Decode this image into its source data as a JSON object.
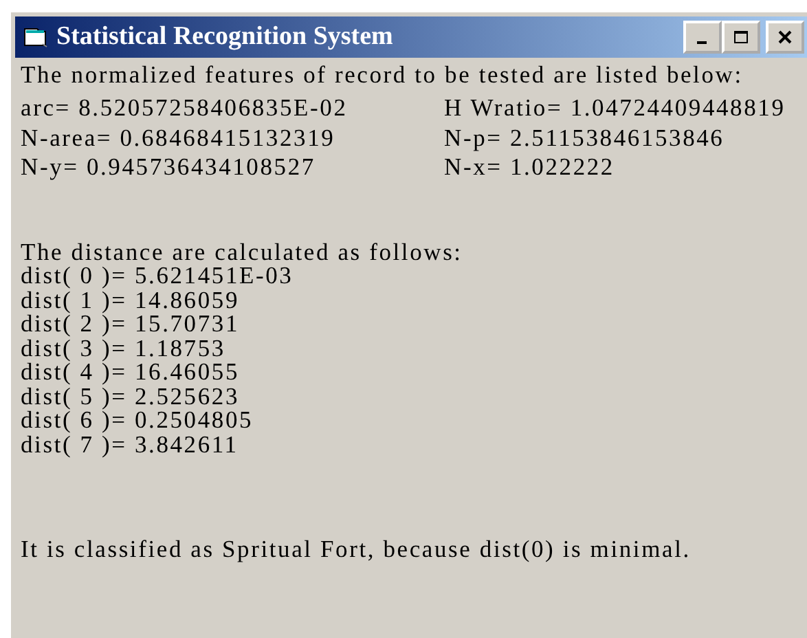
{
  "window": {
    "title": "Statistical Recognition System"
  },
  "intro": "The normalized features of record to be tested are listed below:",
  "features": [
    [
      "arc= 8.52057258406835E-02",
      "H Wratio= 1.04724409448819"
    ],
    [
      "N-area= 0.68468415132319",
      "N-p= 2.51153846153846"
    ],
    [
      "N-y=  0.945736434108527",
      "N-x=  1.022222"
    ]
  ],
  "distance_heading": "The distance are calculated as follows:",
  "distances": [
    "dist( 0 )= 5.621451E-03",
    "dist( 1 )= 14.86059",
    "dist( 2 )= 15.70731",
    "dist( 3 )= 1.18753",
    "dist( 4 )= 16.46055",
    "dist( 5 )= 2.525623",
    "dist( 6 )= 0.2504805",
    "dist( 7 )= 3.842611"
  ],
  "conclusion": "It is classified as Spritual Fort, because dist(0) is minimal."
}
